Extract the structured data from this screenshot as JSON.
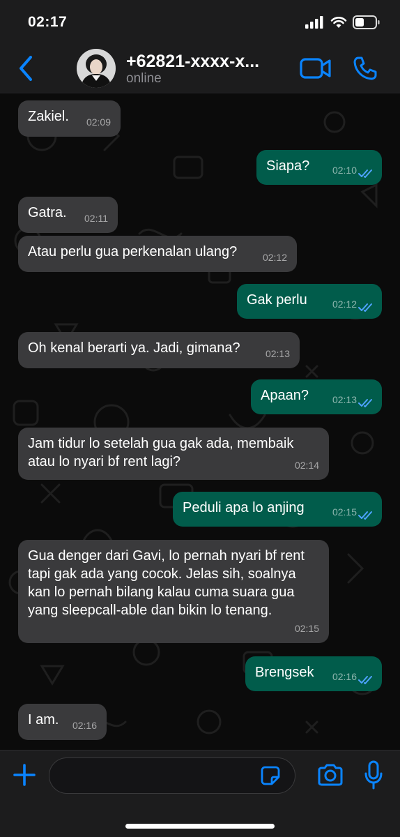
{
  "status_bar": {
    "time": "02:17"
  },
  "header": {
    "contact_name": "+62821-xxxx-x...",
    "contact_status": "online"
  },
  "messages": [
    {
      "direction": "in",
      "text": "Zakiel.",
      "time": "02:09"
    },
    {
      "direction": "out",
      "text": "Siapa?",
      "time": "02:10",
      "read": true
    },
    {
      "direction": "in",
      "text": "Gatra.",
      "time": "02:11"
    },
    {
      "direction": "in",
      "text": "Atau perlu gua perkenalan ulang?",
      "time": "02:12"
    },
    {
      "direction": "out",
      "text": "Gak perlu",
      "time": "02:12",
      "read": true
    },
    {
      "direction": "in",
      "text": "Oh kenal berarti ya. Jadi, gimana?",
      "time": "02:13"
    },
    {
      "direction": "out",
      "text": "Apaan?",
      "time": "02:13",
      "read": true
    },
    {
      "direction": "in",
      "text": "Jam tidur lo setelah gua gak ada, membaik\natau lo nyari bf rent lagi?",
      "time": "02:14"
    },
    {
      "direction": "out",
      "text": "Peduli apa lo anjing",
      "time": "02:15",
      "read": true
    },
    {
      "direction": "in",
      "text": "Gua denger dari Gavi, lo pernah nyari bf rent\ntapi gak ada yang cocok. Jelas sih, soalnya\nkan lo pernah bilang kalau cuma suara gua\nyang sleepcall-able dan bikin lo tenang.",
      "time": "02:15"
    },
    {
      "direction": "out",
      "text": "Brengsek",
      "time": "02:16",
      "read": true
    },
    {
      "direction": "in",
      "text": "I am.",
      "time": "02:16"
    }
  ],
  "input": {
    "placeholder": "",
    "value": ""
  },
  "colors": {
    "accent": "#0a84ff",
    "incoming_bubble": "#3a3a3c",
    "outgoing_bubble": "#015c4b",
    "read_ticks": "#4fa3ff"
  },
  "icons": {
    "back": "chevron-left-icon",
    "video": "video-camera-icon",
    "call": "phone-icon",
    "plus": "plus-icon",
    "sticker": "sticker-icon",
    "camera": "camera-icon",
    "mic": "microphone-icon"
  }
}
